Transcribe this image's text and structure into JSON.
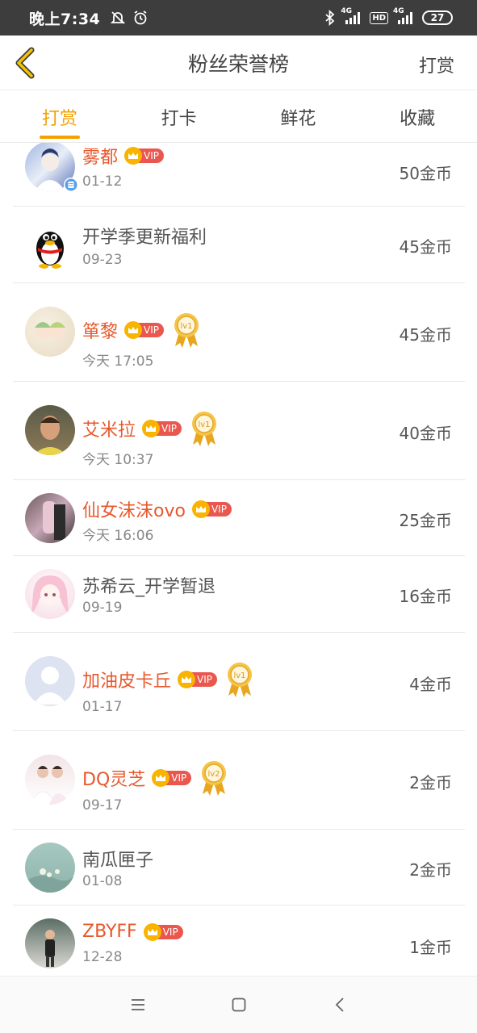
{
  "status_bar": {
    "time": "晚上7:34",
    "network1": "4G",
    "hd": "HD",
    "network2": "4G",
    "battery": "27"
  },
  "header": {
    "title": "粉丝荣誉榜",
    "action_label": "打赏"
  },
  "tabs": [
    {
      "label": "打赏",
      "active": true
    },
    {
      "label": "打卡",
      "active": false
    },
    {
      "label": "鲜花",
      "active": false
    },
    {
      "label": "收藏",
      "active": false
    }
  ],
  "fans": [
    {
      "name": "雾都",
      "vip": true,
      "vip_label": "VIP",
      "level": "",
      "date": "01-12",
      "amount": "50金币",
      "avatar": "anime-character-avatar"
    },
    {
      "name": "开学季更新福利",
      "vip": false,
      "vip_label": "",
      "level": "",
      "date": "09-23",
      "amount": "45金币",
      "avatar": "qq-penguin-avatar"
    },
    {
      "name": "箪黎",
      "vip": true,
      "vip_label": "VIP",
      "level": "lv1",
      "date": "今天 17:05",
      "amount": "45金币",
      "avatar": "chibi-avatar"
    },
    {
      "name": "艾米拉",
      "vip": true,
      "vip_label": "VIP",
      "level": "lv1",
      "date": "今天 10:37",
      "amount": "40金币",
      "avatar": "photo-avatar"
    },
    {
      "name": "仙女沫沫ovo",
      "vip": true,
      "vip_label": "VIP",
      "level": "",
      "date": "今天 16:06",
      "amount": "25金币",
      "avatar": "photo-avatar"
    },
    {
      "name": "苏希云_开学暂退",
      "vip": false,
      "vip_label": "",
      "level": "",
      "date": "09-19",
      "amount": "16金币",
      "avatar": "anime-girl-avatar"
    },
    {
      "name": "加油皮卡丘",
      "vip": true,
      "vip_label": "VIP",
      "level": "lv1",
      "date": "01-17",
      "amount": "4金币",
      "avatar": "default-person-avatar"
    },
    {
      "name": "DQ灵芝",
      "vip": true,
      "vip_label": "VIP",
      "level": "lv2",
      "date": "09-17",
      "amount": "2金币",
      "avatar": "wedding-photo-avatar"
    },
    {
      "name": "南瓜匣子",
      "vip": false,
      "vip_label": "",
      "level": "",
      "date": "01-08",
      "amount": "2金币",
      "avatar": "landscape-avatar"
    },
    {
      "name": "ZBYFF",
      "vip": true,
      "vip_label": "VIP",
      "level": "",
      "date": "12-28",
      "amount": "1金币",
      "avatar": "person-photo-avatar"
    }
  ],
  "colors": {
    "accent": "#f5a000",
    "vip_name": "#e8582c",
    "vip_badge": "#e9574e",
    "status_bar": "#3d3d3d"
  }
}
